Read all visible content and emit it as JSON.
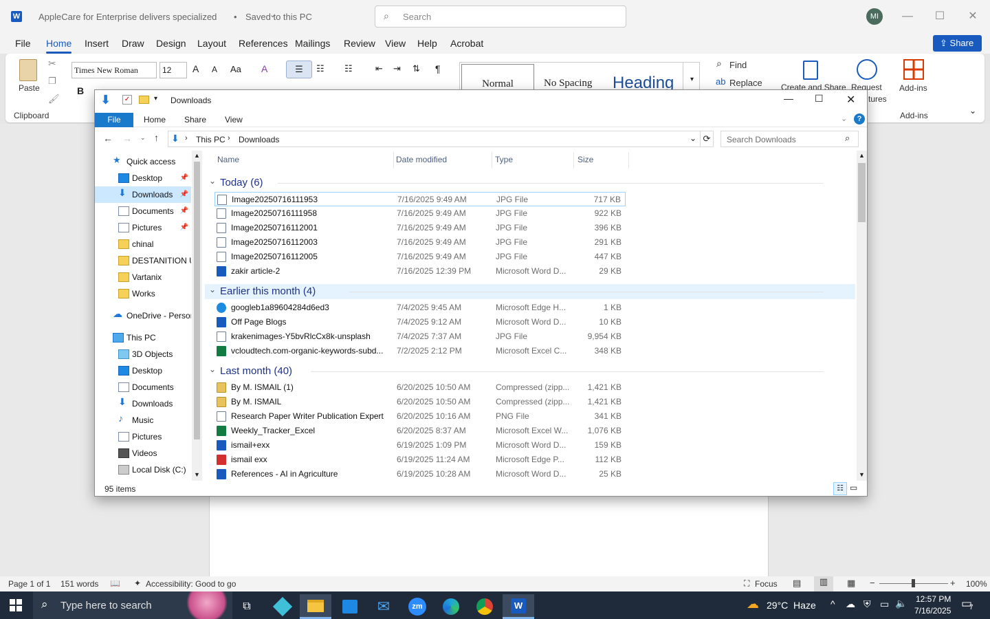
{
  "word": {
    "title": "AppleCare for Enterprise delivers specialized",
    "saved": "Saved to this PC",
    "search_placeholder": "Search",
    "avatar": "MI",
    "share_label": "Share",
    "tabs": [
      "File",
      "Home",
      "Insert",
      "Draw",
      "Design",
      "Layout",
      "References",
      "Mailings",
      "Review",
      "View",
      "Help",
      "Acrobat"
    ],
    "active_tab": "Home",
    "ribbon": {
      "paste": "Paste",
      "clipboard": "Clipboard",
      "font_name": "Times New Roman",
      "font_size": "12",
      "styles": [
        "Normal",
        "No Spacing",
        "Heading"
      ],
      "find": "Find",
      "replace": "Replace",
      "create_share": "Create and Share",
      "request": "Request",
      "signatures_partial": "tures",
      "addins": "Add-ins",
      "addins_group": "Add-ins"
    },
    "status": {
      "page": "Page 1 of 1",
      "words": "151 words",
      "accessibility": "Accessibility: Good to go",
      "focus": "Focus",
      "zoom": "100%"
    }
  },
  "explorer": {
    "title": "Downloads",
    "ribbon_tabs": [
      "File",
      "Home",
      "Share",
      "View"
    ],
    "breadcrumb": [
      "This PC",
      "Downloads"
    ],
    "search_placeholder": "Search Downloads",
    "nav": [
      {
        "label": "Quick access",
        "icon": "star-icon",
        "indent": 0
      },
      {
        "label": "Desktop",
        "icon": "desktop-icon",
        "indent": 1,
        "pinned": true
      },
      {
        "label": "Downloads",
        "icon": "download-arrow-icon",
        "indent": 1,
        "pinned": true,
        "selected": true
      },
      {
        "label": "Documents",
        "icon": "documents-icon",
        "indent": 1,
        "pinned": true
      },
      {
        "label": "Pictures",
        "icon": "pictures-icon",
        "indent": 1,
        "pinned": true
      },
      {
        "label": "chinal",
        "icon": "folder-icon",
        "indent": 1
      },
      {
        "label": "DESTANITION UK",
        "icon": "folder-icon",
        "indent": 1
      },
      {
        "label": "Vartanix",
        "icon": "folder-icon",
        "indent": 1
      },
      {
        "label": "Works",
        "icon": "folder-icon",
        "indent": 1
      },
      {
        "label": "OneDrive - Personal",
        "icon": "cloud-icon",
        "indent": 0
      },
      {
        "label": "This PC",
        "icon": "pc-icon",
        "indent": 0
      },
      {
        "label": "3D Objects",
        "icon": "cube-icon",
        "indent": 1
      },
      {
        "label": "Desktop",
        "icon": "desktop-icon",
        "indent": 1
      },
      {
        "label": "Documents",
        "icon": "documents-icon",
        "indent": 1
      },
      {
        "label": "Downloads",
        "icon": "download-arrow-icon",
        "indent": 1
      },
      {
        "label": "Music",
        "icon": "music-icon",
        "indent": 1
      },
      {
        "label": "Pictures",
        "icon": "pictures-icon",
        "indent": 1
      },
      {
        "label": "Videos",
        "icon": "videos-icon",
        "indent": 1
      },
      {
        "label": "Local Disk (C:)",
        "icon": "disk-icon",
        "indent": 1
      }
    ],
    "columns": [
      "Name",
      "Date modified",
      "Type",
      "Size"
    ],
    "groups": [
      {
        "label": "Today (6)",
        "files": [
          {
            "name": "Image20250716111953",
            "date": "7/16/2025 9:49 AM",
            "type": "JPG File",
            "size": "717 KB",
            "icon": "image",
            "hl": true
          },
          {
            "name": "Image20250716111958",
            "date": "7/16/2025 9:49 AM",
            "type": "JPG File",
            "size": "922 KB",
            "icon": "image"
          },
          {
            "name": "Image20250716112001",
            "date": "7/16/2025 9:49 AM",
            "type": "JPG File",
            "size": "396 KB",
            "icon": "image"
          },
          {
            "name": "Image20250716112003",
            "date": "7/16/2025 9:49 AM",
            "type": "JPG File",
            "size": "291 KB",
            "icon": "image"
          },
          {
            "name": "Image20250716112005",
            "date": "7/16/2025 9:49 AM",
            "type": "JPG File",
            "size": "447 KB",
            "icon": "image"
          },
          {
            "name": "zakir article-2",
            "date": "7/16/2025 12:39 PM",
            "type": "Microsoft Word D...",
            "size": "29 KB",
            "icon": "word"
          }
        ]
      },
      {
        "label": "Earlier this month (4)",
        "selected": true,
        "files": [
          {
            "name": "googleb1a89604284d6ed3",
            "date": "7/4/2025 9:45 AM",
            "type": "Microsoft Edge H...",
            "size": "1 KB",
            "icon": "edge"
          },
          {
            "name": "Off Page Blogs",
            "date": "7/4/2025 9:12 AM",
            "type": "Microsoft Word D...",
            "size": "10 KB",
            "icon": "word"
          },
          {
            "name": "krakenimages-Y5bvRlcCx8k-unsplash",
            "date": "7/4/2025 7:37 AM",
            "type": "JPG File",
            "size": "9,954 KB",
            "icon": "image"
          },
          {
            "name": "vcloudtech.com-organic-keywords-subd...",
            "date": "7/2/2025 2:12 PM",
            "type": "Microsoft Excel C...",
            "size": "348 KB",
            "icon": "excel"
          }
        ]
      },
      {
        "label": "Last month (40)",
        "files": [
          {
            "name": "By M. ISMAIL (1)",
            "date": "6/20/2025 10:50 AM",
            "type": "Compressed (zipp...",
            "size": "1,421 KB",
            "icon": "zip"
          },
          {
            "name": "By M. ISMAIL",
            "date": "6/20/2025 10:50 AM",
            "type": "Compressed (zipp...",
            "size": "1,421 KB",
            "icon": "zip"
          },
          {
            "name": "Research Paper Writer Publication Expert",
            "date": "6/20/2025 10:16 AM",
            "type": "PNG File",
            "size": "341 KB",
            "icon": "image"
          },
          {
            "name": "Weekly_Tracker_Excel",
            "date": "6/20/2025 8:37 AM",
            "type": "Microsoft Excel W...",
            "size": "1,076 KB",
            "icon": "excel"
          },
          {
            "name": "ismail+exx",
            "date": "6/19/2025 1:09 PM",
            "type": "Microsoft Word D...",
            "size": "159 KB",
            "icon": "word"
          },
          {
            "name": "ismail exx",
            "date": "6/19/2025 11:24 AM",
            "type": "Microsoft Edge P...",
            "size": "112 KB",
            "icon": "pdf"
          },
          {
            "name": "References - AI in Agriculture",
            "date": "6/19/2025 10:28 AM",
            "type": "Microsoft Word D...",
            "size": "25 KB",
            "icon": "word"
          }
        ]
      }
    ],
    "item_count": "95 items"
  },
  "taskbar": {
    "search_placeholder": "Type here to search",
    "weather": "29°C  Haze",
    "time": "12:57 PM",
    "date": "7/16/2025",
    "notifications": "7"
  }
}
